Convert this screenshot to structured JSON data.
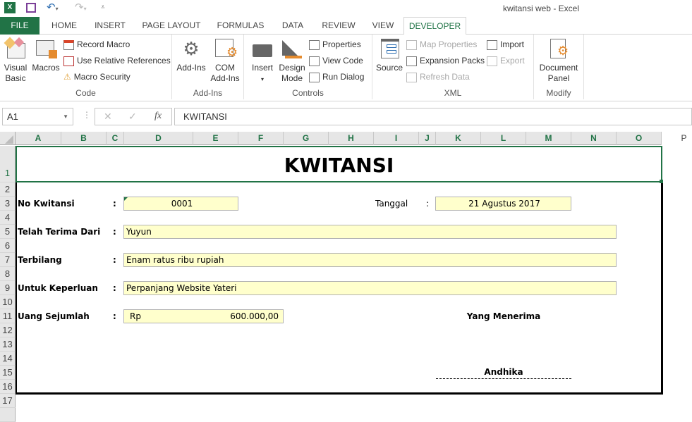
{
  "window": {
    "title": "kwitansi web - Excel"
  },
  "quick_access": {
    "icons": [
      "excel-logo-icon",
      "save-icon",
      "undo-icon",
      "redo-icon",
      "customize-icon"
    ]
  },
  "tabs": [
    "FILE",
    "HOME",
    "INSERT",
    "PAGE LAYOUT",
    "FORMULAS",
    "DATA",
    "REVIEW",
    "VIEW",
    "DEVELOPER"
  ],
  "active_tab": "DEVELOPER",
  "ribbon": {
    "code": {
      "label": "Code",
      "visual_basic": "Visual Basic",
      "macros": "Macros",
      "record_macro": "Record Macro",
      "use_relative": "Use Relative References",
      "macro_security": "Macro Security"
    },
    "addins": {
      "label": "Add-Ins",
      "addins": "Add-Ins",
      "com_addins": "COM Add-Ins"
    },
    "controls": {
      "label": "Controls",
      "insert": "Insert",
      "design_mode": "Design Mode",
      "properties": "Properties",
      "view_code": "View Code",
      "run_dialog": "Run Dialog"
    },
    "xml": {
      "label": "XML",
      "source": "Source",
      "map_properties": "Map Properties",
      "expansion_packs": "Expansion Packs",
      "refresh_data": "Refresh Data",
      "import": "Import",
      "export": "Export"
    },
    "modify": {
      "label": "Modify",
      "document_panel": "Document Panel"
    }
  },
  "formula_bar": {
    "name_box": "A1",
    "formula": "KWITANSI"
  },
  "columns": [
    "A",
    "B",
    "C",
    "D",
    "E",
    "F",
    "G",
    "H",
    "I",
    "J",
    "K",
    "L",
    "M",
    "N",
    "O",
    "P"
  ],
  "rows": [
    "1",
    "2",
    "3",
    "4",
    "5",
    "6",
    "7",
    "8",
    "9",
    "10",
    "11",
    "12",
    "13",
    "14",
    "15",
    "16",
    "17"
  ],
  "sheet": {
    "title": "KWITANSI",
    "no_kwitansi_label": "No Kwitansi",
    "no_kwitansi": "0001",
    "tanggal_label": "Tanggal",
    "tanggal": "21 Agustus 2017",
    "terima_label": "Telah Terima Dari",
    "terima": "Yuyun",
    "terbilang_label": "Terbilang",
    "terbilang": "Enam ratus ribu rupiah",
    "keperluan_label": "Untuk Keperluan",
    "keperluan": "Perpanjang Website Yateri",
    "jumlah_label": "Uang Sejumlah",
    "currency": "Rp",
    "jumlah": "600.000,00",
    "colon": ":",
    "penerima_label": "Yang Menerima",
    "penerima": "Andhika"
  }
}
